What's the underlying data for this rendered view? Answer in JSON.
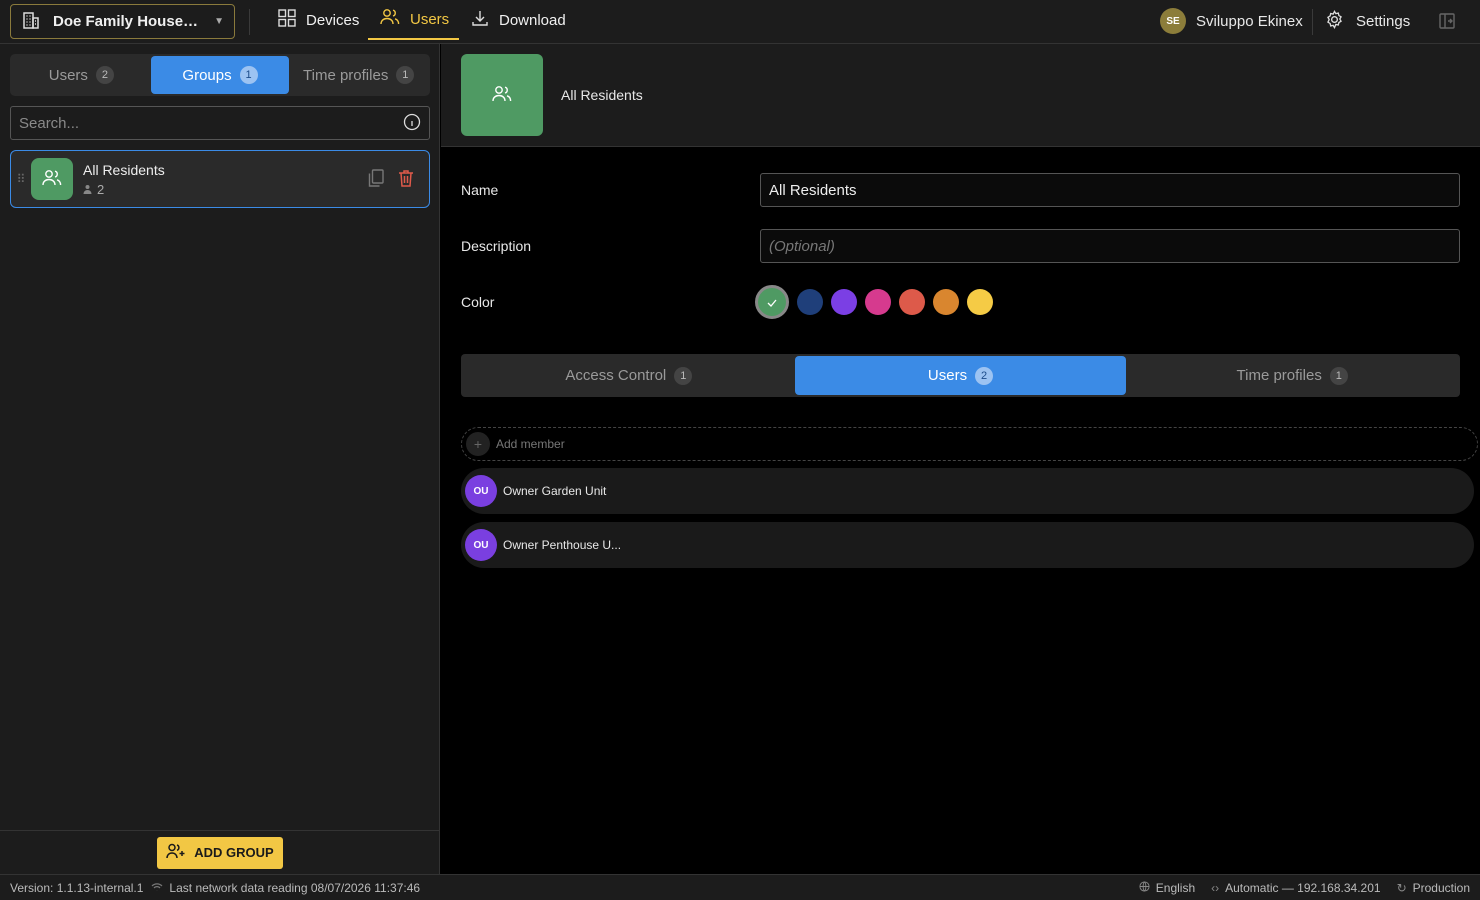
{
  "topbar": {
    "project_name": "Doe Family House Pro...",
    "nav": [
      {
        "label": "Devices",
        "icon": "grid-icon"
      },
      {
        "label": "Users",
        "icon": "users-icon",
        "active": true
      },
      {
        "label": "Download",
        "icon": "download-icon"
      }
    ],
    "user_initials": "SE",
    "user_name": "Sviluppo Ekinex",
    "settings_label": "Settings"
  },
  "sidebar": {
    "tabs": [
      {
        "label": "Users",
        "count": "2"
      },
      {
        "label": "Groups",
        "count": "1",
        "active": true
      },
      {
        "label": "Time profiles",
        "count": "1"
      }
    ],
    "search_placeholder": "Search...",
    "groups": [
      {
        "title": "All Residents",
        "member_count": "2",
        "color": "#4f9a63"
      }
    ],
    "add_button_label": "ADD GROUP"
  },
  "detail": {
    "title": "All Residents",
    "name_label": "Name",
    "name_value": "All Residents",
    "description_label": "Description",
    "description_placeholder": "(Optional)",
    "color_label": "Color",
    "colors": [
      "#4f9a63",
      "#1f3f7a",
      "#7b3fe4",
      "#d63a8e",
      "#dd5a4a",
      "#d9862f",
      "#f5cb45"
    ],
    "selected_color": "#4f9a63",
    "tabs": [
      {
        "label": "Access Control",
        "count": "1"
      },
      {
        "label": "Users",
        "count": "2",
        "active": true
      },
      {
        "label": "Time profiles",
        "count": "1"
      }
    ],
    "add_member_label": "Add member",
    "members": [
      {
        "initials": "OU",
        "name": "Owner Garden Unit"
      },
      {
        "initials": "OU",
        "name": "Owner Penthouse U..."
      }
    ]
  },
  "statusbar": {
    "version": "Version: 1.1.13-internal.1",
    "last_reading": "Last network data reading 08/07/2026 11:37:46",
    "language": "English",
    "connection": "Automatic — 192.168.34.201",
    "environment": "Production"
  }
}
